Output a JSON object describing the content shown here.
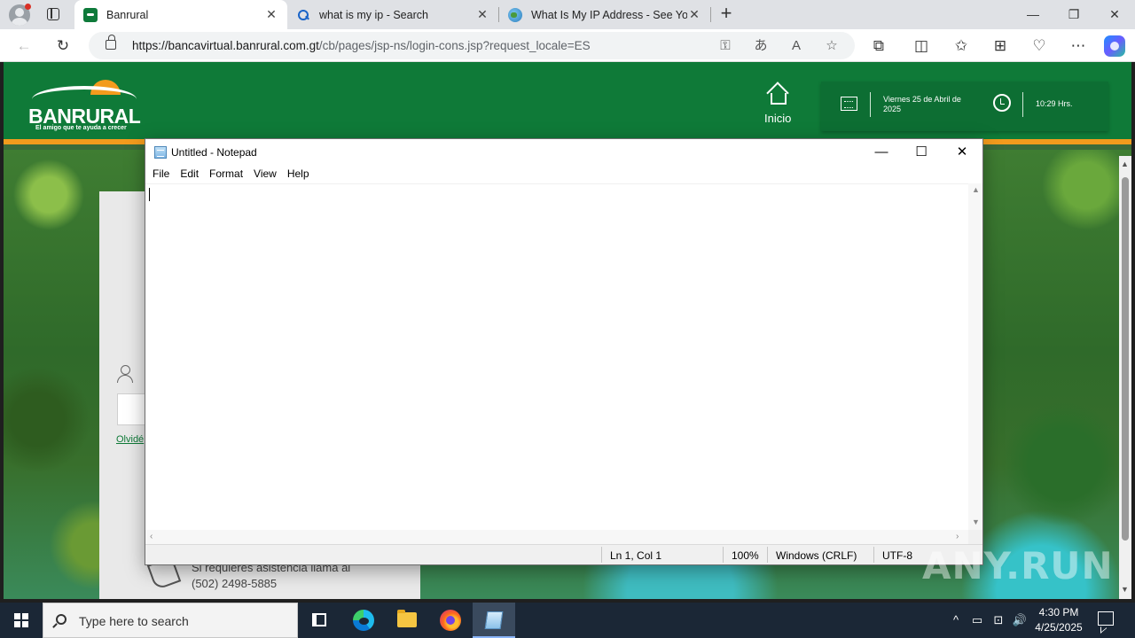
{
  "browser": {
    "tabs": [
      {
        "title": "Banrural",
        "favicon": "banrural-favicon",
        "active": true
      },
      {
        "title": "what is my ip - Search",
        "favicon": "search-favicon",
        "active": false
      },
      {
        "title": "What Is My IP Address - See Your",
        "favicon": "globe-favicon",
        "active": false
      }
    ],
    "close_glyph": "✕",
    "new_tab_glyph": "+",
    "window_controls": {
      "minimize": "—",
      "restore": "❐",
      "close": "✕"
    },
    "address": {
      "origin": "https://bancavirtual.banrural.com.gt",
      "path": "/cb/pages/jsp-ns/login-cons.jsp?request_locale=ES"
    },
    "nav": {
      "back": "←",
      "refresh": "↻"
    },
    "toolbar_icons": [
      "key-icon",
      "translate-icon",
      "read-aloud-icon",
      "favorite-star-icon",
      "extensions-icon",
      "split-screen-icon",
      "favorites-icon",
      "collections-icon",
      "browser-essentials-icon",
      "more-icon",
      "copilot-icon"
    ],
    "toolbar_glyphs": {
      "key": "⚿",
      "translate": "あ",
      "read_aloud": "A",
      "star": "☆",
      "extensions": "⧉",
      "split": "◫",
      "favorites": "✩",
      "collections": "⊞",
      "essentials": "♡",
      "more": "⋯"
    }
  },
  "site": {
    "logo_text": "BANRURAL",
    "logo_tagline": "El amigo que te ayuda a crecer",
    "nav_home_label": "Inicio",
    "date_text": "Viernes 25 de Abril de 2025",
    "time_text": "10:29 Hrs.",
    "forgot_link": "Olvidé",
    "assist_line1": "Si requieres asistencia llama al",
    "assist_line2": "(502) 2498-5885",
    "colors": {
      "brand_green": "#0f7a38",
      "brand_orange": "#f39b1d"
    }
  },
  "notepad": {
    "title": "Untitled - Notepad",
    "menu": [
      "File",
      "Edit",
      "Format",
      "View",
      "Help"
    ],
    "content": "",
    "status": {
      "position": "Ln 1, Col 1",
      "zoom": "100%",
      "line_endings": "Windows (CRLF)",
      "encoding": "UTF-8"
    },
    "window_controls": {
      "minimize": "—",
      "maximize": "☐",
      "close": "✕"
    }
  },
  "watermark": "ANY.RUN",
  "taskbar": {
    "search_placeholder": "Type here to search",
    "apps": [
      "task-view",
      "microsoft-edge",
      "file-explorer",
      "firefox",
      "notepad"
    ],
    "active_app": "notepad",
    "tray_glyphs": {
      "chevron": "^",
      "battery": "▭",
      "network": "⊡",
      "volume": "🔊"
    },
    "time": "4:30 PM",
    "date": "4/25/2025"
  }
}
